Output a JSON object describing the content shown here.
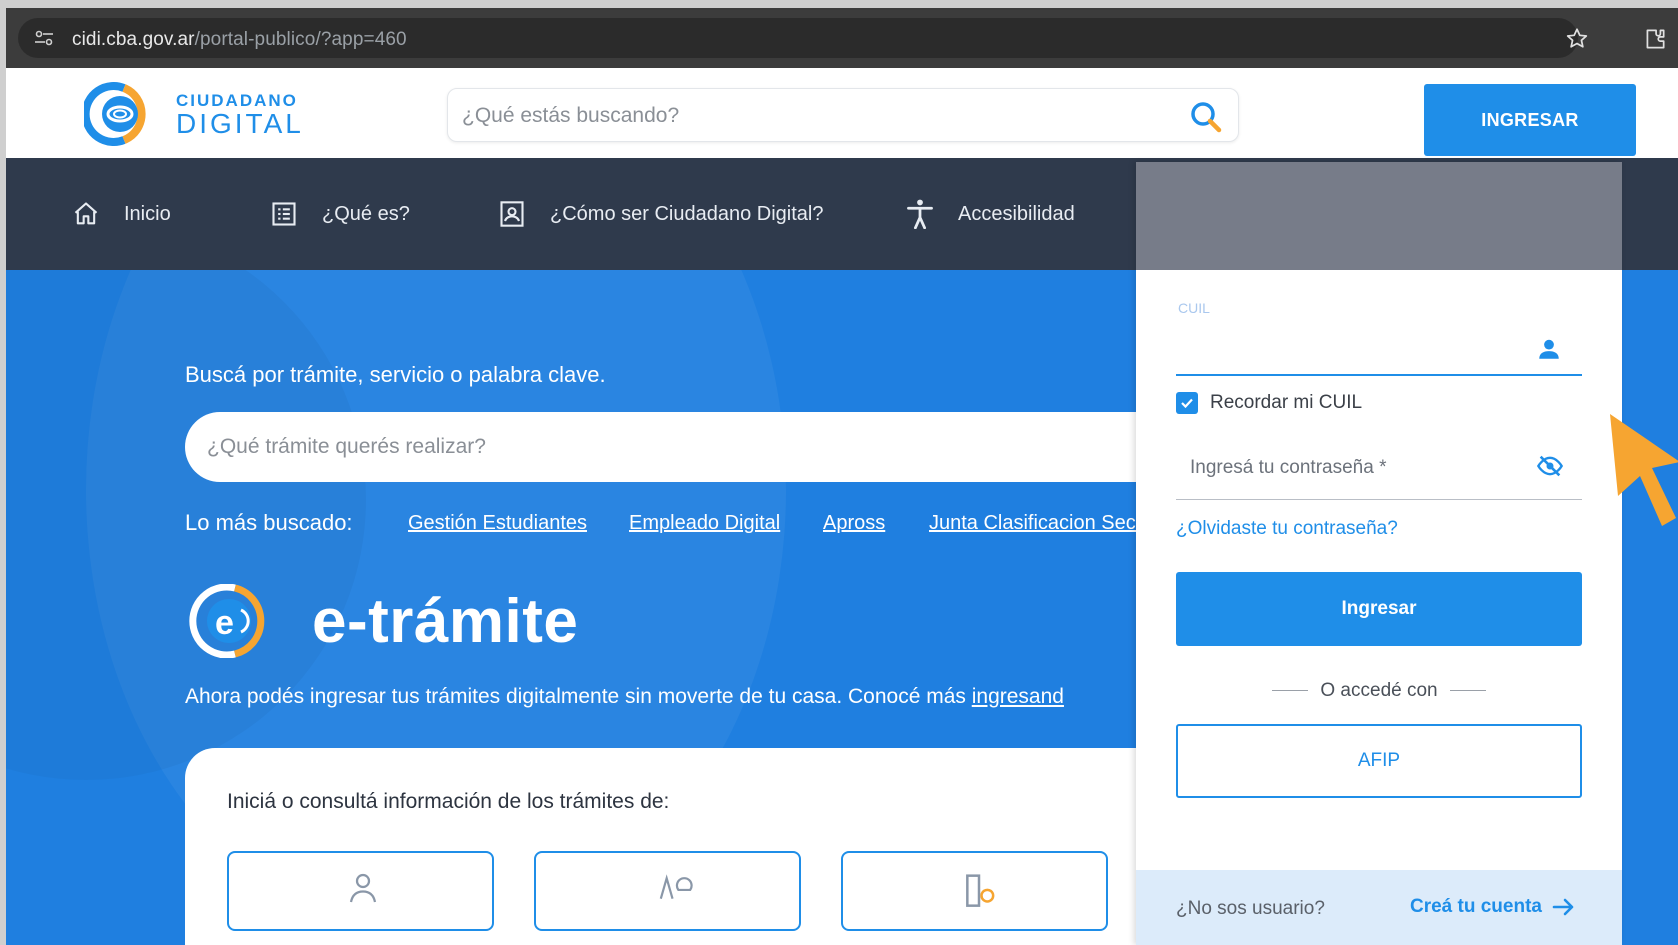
{
  "browser": {
    "url_host": "cidi.cba.gov.ar",
    "url_path": "/portal-publico/?app=460"
  },
  "header": {
    "logo_top": "CIUDADANO",
    "logo_bottom": "DIGITAL",
    "search_placeholder": "¿Qué estás buscando?",
    "login_button": "INGRESAR"
  },
  "nav": {
    "items": [
      {
        "label": "Inicio",
        "icon": "home-icon"
      },
      {
        "label": "¿Qué es?",
        "icon": "list-icon"
      },
      {
        "label": "¿Cómo ser Ciudadano Digital?",
        "icon": "id-card-icon"
      },
      {
        "label": "Accesibilidad",
        "icon": "accessibility-icon"
      }
    ]
  },
  "hero": {
    "subtitle": "Buscá por trámite, servicio o palabra clave.",
    "search_placeholder": "¿Qué trámite querés realizar?",
    "popular_label": "Lo más buscado:",
    "popular_links": [
      "Gestión Estudiantes",
      "Empleado Digital",
      "Apross",
      "Junta Clasificacion Secu"
    ],
    "brand_title": "e-trámite",
    "description": "Ahora podés ingresar tus trámites digitalmente sin moverte de tu casa. Conocé más ",
    "description_link": "ingresand",
    "card_text": "Iniciá o consultá información de los trámites de:"
  },
  "login": {
    "cuil_label": "CUIL",
    "cuil_value": "",
    "remember_label": "Recordar mi CUIL",
    "remember_checked": true,
    "password_placeholder": "Ingresá tu contraseña *",
    "forgot_link": "¿Olvidaste tu contraseña?",
    "submit_button": "Ingresar",
    "divider_text": "O accedé con",
    "afip_button": "AFIP",
    "footer_question": "¿No sos usuario?",
    "footer_link": "Creá tu cuenta"
  },
  "colors": {
    "brand_blue": "#1f8ee8",
    "nav_bg": "#2f3a4c",
    "hero_bg": "#1f7fe0",
    "accent_orange": "#f6a531"
  }
}
